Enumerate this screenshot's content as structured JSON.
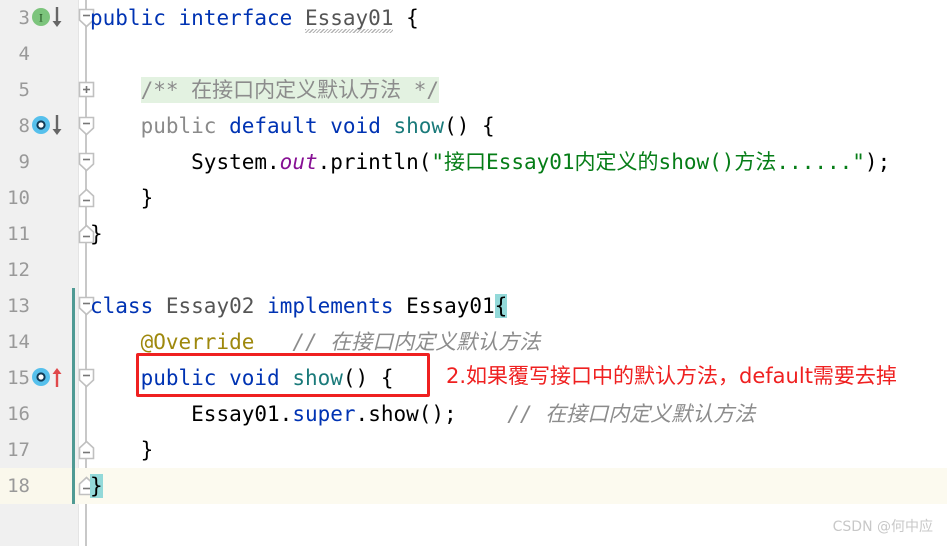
{
  "editor": {
    "name": "intellij-java-editor",
    "colors": {
      "background": "#ffffff",
      "gutter_background": "#f0f0f0",
      "current_line_background": "#fcfaef",
      "keyword": "#0033b3",
      "string": "#067d17",
      "comment": "#8c8c8c",
      "annotation": "#9e880d",
      "static_field": "#871094",
      "method_name": "#1a7a7a",
      "doc_highlight": "#e3f2e1",
      "brace_match_highlight": "#93d9d9",
      "change_marker": "#4f9a94",
      "annotation_red": "#ef2020"
    },
    "lines": [
      {
        "number": "3",
        "fold": "collapse-start",
        "gutter_icon": "interface-implemented-down-icon",
        "current": false,
        "changed": false,
        "tokens": [
          {
            "text": "public",
            "cls": "kw"
          },
          {
            "text": " ",
            "cls": "punct"
          },
          {
            "text": "interface",
            "cls": "kw"
          },
          {
            "text": " ",
            "cls": "punct"
          },
          {
            "text": "Essay01",
            "cls": "type squiggle"
          },
          {
            "text": " {",
            "cls": "punct"
          }
        ]
      },
      {
        "number": "4",
        "fold": "none",
        "gutter_icon": "none",
        "current": false,
        "changed": false,
        "tokens": []
      },
      {
        "number": "5",
        "fold": "expand",
        "gutter_icon": "none",
        "current": false,
        "changed": false,
        "tokens": [
          {
            "text": "    ",
            "cls": "punct"
          },
          {
            "text": "/** 在接口内定义默认方法 */",
            "cls": "doc doc-hl"
          }
        ]
      },
      {
        "number": "8",
        "fold": "collapse-start",
        "gutter_icon": "method-overridden-down-icon",
        "current": false,
        "changed": false,
        "tokens": [
          {
            "text": "    ",
            "cls": "punct"
          },
          {
            "text": "public",
            "cls": "dim"
          },
          {
            "text": " ",
            "cls": "punct"
          },
          {
            "text": "default",
            "cls": "kw"
          },
          {
            "text": " ",
            "cls": "punct"
          },
          {
            "text": "void",
            "cls": "kw"
          },
          {
            "text": " ",
            "cls": "punct"
          },
          {
            "text": "show",
            "cls": "method"
          },
          {
            "text": "() {",
            "cls": "punct"
          }
        ]
      },
      {
        "number": "9",
        "fold": "collapse-start",
        "gutter_icon": "none",
        "current": false,
        "changed": false,
        "tokens": [
          {
            "text": "        ",
            "cls": "punct"
          },
          {
            "text": "System",
            "cls": "punct"
          },
          {
            "text": ".",
            "cls": "punct"
          },
          {
            "text": "out",
            "cls": "field"
          },
          {
            "text": ".println(",
            "cls": "punct"
          },
          {
            "text": "\"接口Essay01内定义的show()方法......\"",
            "cls": "str"
          },
          {
            "text": ");",
            "cls": "punct"
          }
        ]
      },
      {
        "number": "10",
        "fold": "fold-end",
        "gutter_icon": "none",
        "current": false,
        "changed": false,
        "tokens": [
          {
            "text": "    }",
            "cls": "punct"
          }
        ]
      },
      {
        "number": "11",
        "fold": "fold-end",
        "gutter_icon": "none",
        "current": false,
        "changed": false,
        "tokens": [
          {
            "text": "}",
            "cls": "punct"
          }
        ]
      },
      {
        "number": "12",
        "fold": "none",
        "gutter_icon": "none",
        "current": false,
        "changed": false,
        "tokens": []
      },
      {
        "number": "13",
        "fold": "collapse-start",
        "gutter_icon": "none",
        "current": false,
        "changed": true,
        "tokens": [
          {
            "text": "class",
            "cls": "kw"
          },
          {
            "text": " ",
            "cls": "punct"
          },
          {
            "text": "Essay02",
            "cls": "type"
          },
          {
            "text": " ",
            "cls": "punct"
          },
          {
            "text": "implements",
            "cls": "kw"
          },
          {
            "text": " ",
            "cls": "punct"
          },
          {
            "text": "Essay01",
            "cls": "punct"
          },
          {
            "text": "{",
            "cls": "punct brace-hl"
          }
        ]
      },
      {
        "number": "14",
        "fold": "none",
        "gutter_icon": "none",
        "current": false,
        "changed": true,
        "tokens": [
          {
            "text": "    ",
            "cls": "punct"
          },
          {
            "text": "@Override",
            "cls": "anno"
          },
          {
            "text": "   ",
            "cls": "punct"
          },
          {
            "text": "// 在接口内定义默认方法",
            "cls": "cmt"
          }
        ]
      },
      {
        "number": "15",
        "fold": "collapse-start",
        "gutter_icon": "method-overriding-up-icon",
        "current": false,
        "changed": true,
        "tokens": [
          {
            "text": "    ",
            "cls": "punct"
          },
          {
            "text": "public",
            "cls": "kw"
          },
          {
            "text": " ",
            "cls": "punct"
          },
          {
            "text": "void",
            "cls": "kw"
          },
          {
            "text": " ",
            "cls": "punct"
          },
          {
            "text": "show",
            "cls": "method"
          },
          {
            "text": "() {",
            "cls": "punct"
          }
        ]
      },
      {
        "number": "16",
        "fold": "none",
        "gutter_icon": "none",
        "current": false,
        "changed": true,
        "tokens": [
          {
            "text": "        ",
            "cls": "punct"
          },
          {
            "text": "Essay01",
            "cls": "punct"
          },
          {
            "text": ".",
            "cls": "punct"
          },
          {
            "text": "super",
            "cls": "kw"
          },
          {
            "text": ".show();",
            "cls": "punct"
          },
          {
            "text": "    ",
            "cls": "punct"
          },
          {
            "text": "// 在接口内定义默认方法",
            "cls": "cmt"
          }
        ]
      },
      {
        "number": "17",
        "fold": "fold-end",
        "gutter_icon": "none",
        "current": false,
        "changed": true,
        "tokens": [
          {
            "text": "    }",
            "cls": "punct"
          }
        ]
      },
      {
        "number": "18",
        "fold": "fold-end",
        "gutter_icon": "none",
        "current": true,
        "changed": true,
        "tokens": [
          {
            "text": "}",
            "cls": "punct brace-hl"
          }
        ]
      }
    ]
  },
  "annotation": {
    "red_note": "2.如果覆写接口中的默认方法，default需要去掉",
    "highlight_target_line": "15"
  },
  "watermark": {
    "text": "CSDN @何中应"
  }
}
